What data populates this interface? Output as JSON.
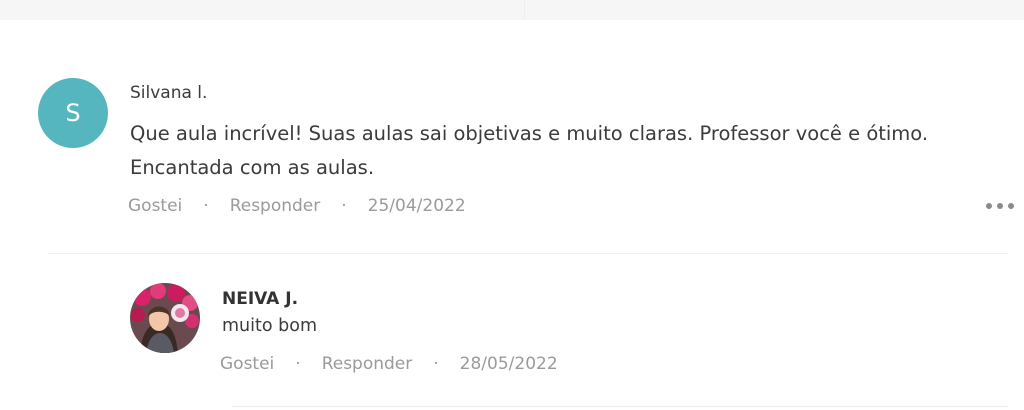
{
  "comments": [
    {
      "author": "Silvana l.",
      "avatar_initial": "S",
      "avatar_color": "#56b6bf",
      "text": "Que aula incrível! Suas aulas sai objetivas e muito claras. Professor você e ótimo. Encantada com as aulas.",
      "like_label": "Gostei",
      "reply_label": "Responder",
      "date": "25/04/2022",
      "separator": "·",
      "more_icon": "more-horizontal-icon"
    }
  ],
  "replies": [
    {
      "author": "NEIVA J.",
      "avatar_type": "photo",
      "text": "muito bom",
      "like_label": "Gostei",
      "reply_label": "Responder",
      "date": "28/05/2022",
      "separator": "·"
    }
  ],
  "colors": {
    "meta_text": "#9a9a9a",
    "body_text": "#3b3b3b",
    "top_bar": "#f6f6f7"
  }
}
